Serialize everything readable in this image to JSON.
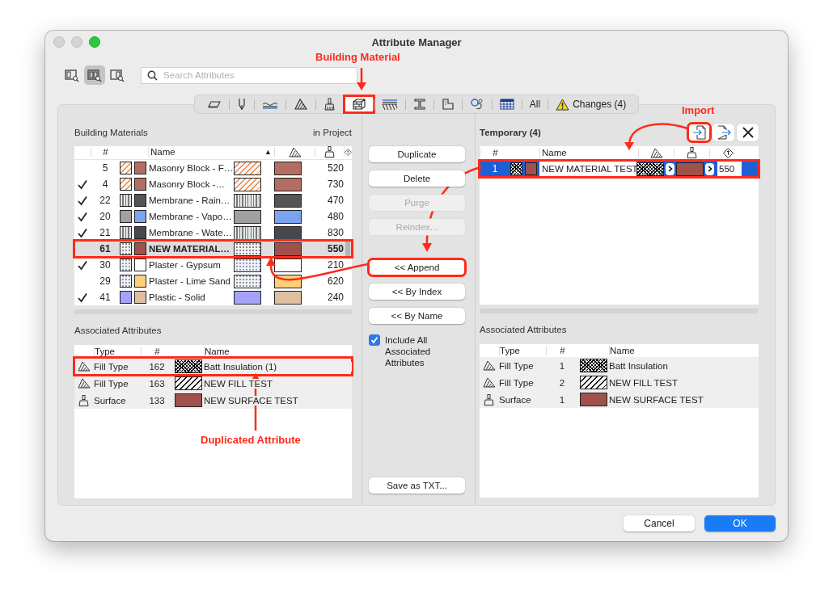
{
  "window": {
    "title": "Attribute Manager"
  },
  "view_modes": [
    {
      "kind": "left",
      "selected": false
    },
    {
      "kind": "both",
      "selected": true
    },
    {
      "kind": "right",
      "selected": false
    }
  ],
  "search": {
    "placeholder": "Search Attributes"
  },
  "toolbar": [
    {
      "kind": "layers",
      "selected": false,
      "highlighted": false
    },
    {
      "kind": "pen",
      "selected": false,
      "highlighted": false
    },
    {
      "kind": "line",
      "selected": false,
      "highlighted": false
    },
    {
      "kind": "fill",
      "selected": false,
      "highlighted": false
    },
    {
      "kind": "surface",
      "selected": false,
      "highlighted": false
    },
    {
      "kind": "material",
      "selected": true,
      "highlighted": true
    },
    {
      "kind": "composite",
      "selected": false,
      "highlighted": false
    },
    {
      "kind": "profile",
      "selected": false,
      "highlighted": false
    },
    {
      "kind": "zone",
      "selected": false,
      "highlighted": false
    },
    {
      "kind": "mep",
      "selected": false,
      "highlighted": false
    },
    {
      "kind": "grid",
      "selected": false,
      "highlighted": false
    },
    {
      "kind": "all",
      "label": "All",
      "selected": false,
      "highlighted": false
    },
    {
      "kind": "changes",
      "label": "Changes (4)",
      "selected": false,
      "highlighted": false
    }
  ],
  "left": {
    "title": "Building Materials",
    "summary": "in Project",
    "columns": {
      "number": "#",
      "name": "Name",
      "sort_indicator": "▲"
    },
    "rows": [
      {
        "number": "5",
        "in_project": false,
        "fill": {
          "kind": "diagonal",
          "color": "#f08a4a"
        },
        "surface": {
          "color": "#b36d63"
        },
        "name": "Masonry Block - F…",
        "value": "520",
        "selected": false,
        "highlighted": false
      },
      {
        "number": "4",
        "in_project": true,
        "fill": {
          "kind": "diagonal",
          "color": "#f08a4a"
        },
        "surface": {
          "color": "#b36d63"
        },
        "name": "Masonry Block -…",
        "value": "730",
        "selected": false,
        "highlighted": false
      },
      {
        "number": "22",
        "in_project": true,
        "fill": {
          "kind": "vertical",
          "color": "#7a7a7a"
        },
        "surface": {
          "color": "#555555"
        },
        "name": "Membrane - Rain…",
        "value": "470",
        "selected": false,
        "highlighted": false
      },
      {
        "number": "20",
        "in_project": true,
        "fill": {
          "kind": "solid",
          "color": "#a0a0a0"
        },
        "surface": {
          "color": "#7ba3f0"
        },
        "name": "Membrane - Vapo…",
        "value": "480",
        "selected": false,
        "highlighted": false
      },
      {
        "number": "21",
        "in_project": true,
        "fill": {
          "kind": "vertical",
          "color": "#7a7a7a"
        },
        "surface": {
          "color": "#48484c"
        },
        "name": "Membrane - Wate…",
        "value": "830",
        "selected": false,
        "highlighted": false
      },
      {
        "number": "61",
        "in_project": false,
        "fill": {
          "kind": "dots",
          "color": "#8c8c8c"
        },
        "surface": {
          "color": "#a0514a"
        },
        "name": "NEW MATERIAL…",
        "value": "550",
        "selected": true,
        "highlighted": true
      },
      {
        "number": "30",
        "in_project": true,
        "fill": {
          "kind": "dots",
          "color": "#8aa0c8"
        },
        "surface": {
          "color": "#ffffff"
        },
        "name": "Plaster - Gypsum",
        "value": "210",
        "selected": false,
        "highlighted": false
      },
      {
        "number": "29",
        "in_project": false,
        "fill": {
          "kind": "dots",
          "color": "#8a98b0"
        },
        "surface": {
          "color": "#ffcf7a"
        },
        "name": "Plaster - Lime Sand",
        "value": "620",
        "selected": false,
        "highlighted": false
      },
      {
        "number": "41",
        "in_project": true,
        "fill": {
          "kind": "solid",
          "color": "#a6a2f8"
        },
        "surface": {
          "color": "#e0bfa0"
        },
        "name": "Plastic - Solid",
        "value": "240",
        "selected": false,
        "highlighted": false
      }
    ]
  },
  "left_associated": {
    "title": "Associated Attributes",
    "columns": {
      "type": "Type",
      "number": "#",
      "name": "Name"
    },
    "rows": [
      {
        "kind": "fill",
        "type": "Fill Type",
        "number": "162",
        "swatch": {
          "kind": "crosshatch",
          "color": "#000000"
        },
        "name": "Batt Insulation (1)",
        "highlighted": true
      },
      {
        "kind": "fill",
        "type": "Fill Type",
        "number": "163",
        "swatch": {
          "kind": "diagonal",
          "color": "#000000"
        },
        "name": "NEW FILL TEST",
        "highlighted": false
      },
      {
        "kind": "surface",
        "type": "Surface",
        "number": "133",
        "swatch": {
          "kind": "solid",
          "color": "#a0514a"
        },
        "name": "NEW SURFACE TEST",
        "highlighted": false
      }
    ]
  },
  "actions": [
    {
      "label": "Duplicate",
      "disabled": false,
      "highlighted": false
    },
    {
      "label": "Delete",
      "disabled": false,
      "highlighted": false
    },
    {
      "label": "Purge",
      "disabled": true,
      "highlighted": false
    },
    {
      "label": "Reindex...",
      "disabled": true,
      "highlighted": false
    },
    {
      "label": "<< Append",
      "disabled": false,
      "highlighted": true
    },
    {
      "label": "<< By Index",
      "disabled": false,
      "highlighted": false
    },
    {
      "label": "<< By Name",
      "disabled": false,
      "highlighted": false
    }
  ],
  "include_associated": {
    "label": "Include All Associated Attributes",
    "checked": true
  },
  "save_button": "Save as TXT...",
  "right": {
    "title": "Temporary (4)",
    "file_buttons": [
      {
        "kind": "import",
        "highlighted": true
      },
      {
        "kind": "export",
        "highlighted": false
      },
      {
        "kind": "close",
        "highlighted": false
      }
    ],
    "columns": {
      "number": "#",
      "name": "Name"
    },
    "rows": [
      {
        "number": "1",
        "fill": {
          "kind": "crosshatch",
          "color": "#000000"
        },
        "surface": {
          "color": "#a0514a"
        },
        "name": "NEW MATERIAL TEST",
        "value": "550",
        "selected": true,
        "highlighted": true
      }
    ]
  },
  "right_associated": {
    "title": "Associated Attributes",
    "columns": {
      "type": "Type",
      "number": "#",
      "name": "Name"
    },
    "rows": [
      {
        "kind": "fill",
        "type": "Fill Type",
        "number": "1",
        "swatch": {
          "kind": "crosshatch",
          "color": "#000000"
        },
        "name": "Batt Insulation",
        "highlighted": false
      },
      {
        "kind": "fill",
        "type": "Fill Type",
        "number": "2",
        "swatch": {
          "kind": "diagonal",
          "color": "#000000"
        },
        "name": "NEW FILL TEST",
        "highlighted": false
      },
      {
        "kind": "surface",
        "type": "Surface",
        "number": "1",
        "swatch": {
          "kind": "solid",
          "color": "#a0514a"
        },
        "name": "NEW SURFACE TEST",
        "highlighted": false
      }
    ]
  },
  "footer": [
    {
      "label": "Cancel",
      "kind": "default"
    },
    {
      "label": "OK",
      "kind": "primary"
    }
  ],
  "annotations": [
    {
      "text": "Building Material"
    },
    {
      "text": "Import"
    },
    {
      "text": "Duplicated Attribute"
    }
  ]
}
